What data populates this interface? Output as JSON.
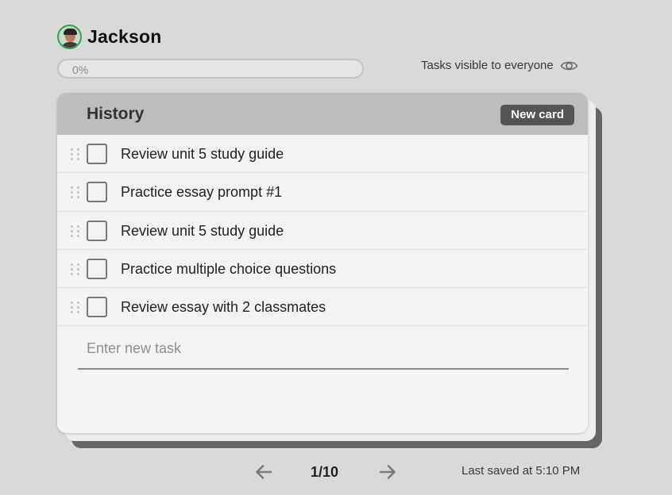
{
  "user": {
    "name": "Jackson",
    "avatar_icon": "user-avatar"
  },
  "progress": {
    "percent": 0,
    "label": "0%"
  },
  "visibility": {
    "text": "Tasks visible to everyone",
    "icon": "eye-icon"
  },
  "card": {
    "title": "History",
    "new_card_label": "New card",
    "tasks": [
      {
        "text": "Review unit 5 study guide",
        "checked": false
      },
      {
        "text": "Practice essay prompt #1",
        "checked": false
      },
      {
        "text": "Review unit 5 study guide",
        "checked": false
      },
      {
        "text": "Practice multiple choice questions",
        "checked": false
      },
      {
        "text": "Review essay with 2 classmates",
        "checked": false
      }
    ],
    "new_task_placeholder": "Enter new task"
  },
  "pager": {
    "current": "1/10",
    "prev_icon": "arrow-left-icon",
    "next_icon": "arrow-right-icon"
  },
  "status": {
    "saved_text": "Last saved at 5:10 PM"
  },
  "colors": {
    "avatar_ring": "#31a24c",
    "card_header": "#bdbdbd",
    "button_bg": "#555555",
    "page_bg": "#d9d9d9"
  }
}
